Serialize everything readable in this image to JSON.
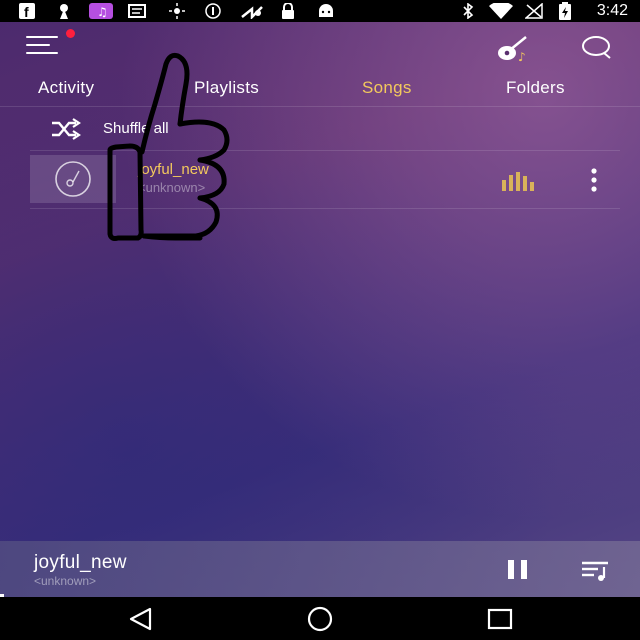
{
  "status_bar": {
    "time": "3:42",
    "icons": [
      "facebook-icon",
      "keyhole-icon",
      "music-app-icon",
      "messages-icon",
      "brightness-icon",
      "info-icon",
      "fast-forward-icon",
      "lock-icon",
      "android-icon",
      "bluetooth-icon",
      "wifi-icon",
      "no-signal-icon",
      "battery-icon"
    ]
  },
  "app_bar": {
    "menu_icon": "hamburger-menu-icon",
    "notification_dot_color": "#ff1f3d",
    "guitar_icon": "guitar-icon",
    "search_icon": "search-icon"
  },
  "tabs": [
    {
      "label": "Activity",
      "active": false
    },
    {
      "label": "Playlists",
      "active": false
    },
    {
      "label": "Songs",
      "active": true
    },
    {
      "label": "Folders",
      "active": false
    }
  ],
  "accent_color": "#f3c95d",
  "shuffle": {
    "label": "Shuffle all",
    "icon": "shuffle-icon"
  },
  "songs": [
    {
      "title": "joyful_new",
      "artist": "<unknown>",
      "playing": true
    }
  ],
  "now_playing": {
    "title": "joyful_new",
    "artist": "<unknown>",
    "state": "playing",
    "progress": 0.006
  },
  "nav": {
    "back": "back-icon",
    "home": "home-icon",
    "recents": "recents-icon"
  }
}
